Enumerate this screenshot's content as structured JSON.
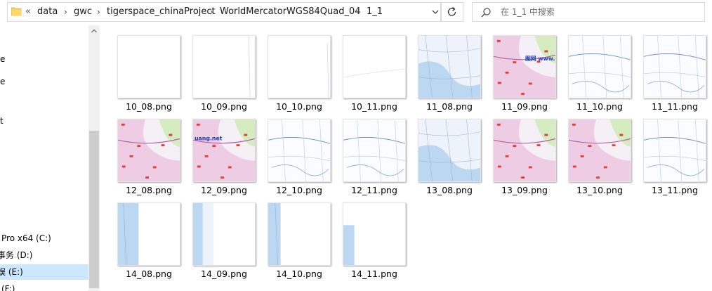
{
  "address_bar": {
    "overflow": "«",
    "breadcrumbs": [
      "data",
      "gwc",
      "tigerspace_chinaProject",
      "WorldMercatorWGS84Quad_04",
      "1_1"
    ]
  },
  "search": {
    "placeholder": "在 1_1 中搜索"
  },
  "nav": {
    "top_fragments": [
      "e",
      "e",
      "",
      "t"
    ],
    "items": [
      {
        "label": "Pro x64 (C:)"
      },
      {
        "label": "事务 (D:)"
      },
      {
        "label": "娱 (E:)",
        "selected": true
      },
      {
        "label": "(F:)"
      }
    ]
  },
  "files": [
    {
      "name": "10_08.png"
    },
    {
      "name": "10_09.png"
    },
    {
      "name": "10_10.png"
    },
    {
      "name": "10_11.png"
    },
    {
      "name": "11_08.png"
    },
    {
      "name": "11_09.png"
    },
    {
      "name": "11_10.png"
    },
    {
      "name": "11_11.png"
    },
    {
      "name": "12_08.png"
    },
    {
      "name": "12_09.png"
    },
    {
      "name": "12_10.png"
    },
    {
      "name": "12_11.png"
    },
    {
      "name": "13_08.png"
    },
    {
      "name": "13_09.png"
    },
    {
      "name": "13_10.png"
    },
    {
      "name": "13_11.png"
    },
    {
      "name": "14_08.png"
    },
    {
      "name": "14_09.png"
    },
    {
      "name": "14_10.png"
    },
    {
      "name": "14_11.png"
    }
  ],
  "thumb_texts": {
    "11_09": "图网 www.g",
    "12_09": "uang.net"
  },
  "colors": {
    "selection": "#cce8ff",
    "map_blue": "#bcd7f2",
    "map_pink": "#e9b0d6",
    "map_green": "#d4ecc0"
  }
}
